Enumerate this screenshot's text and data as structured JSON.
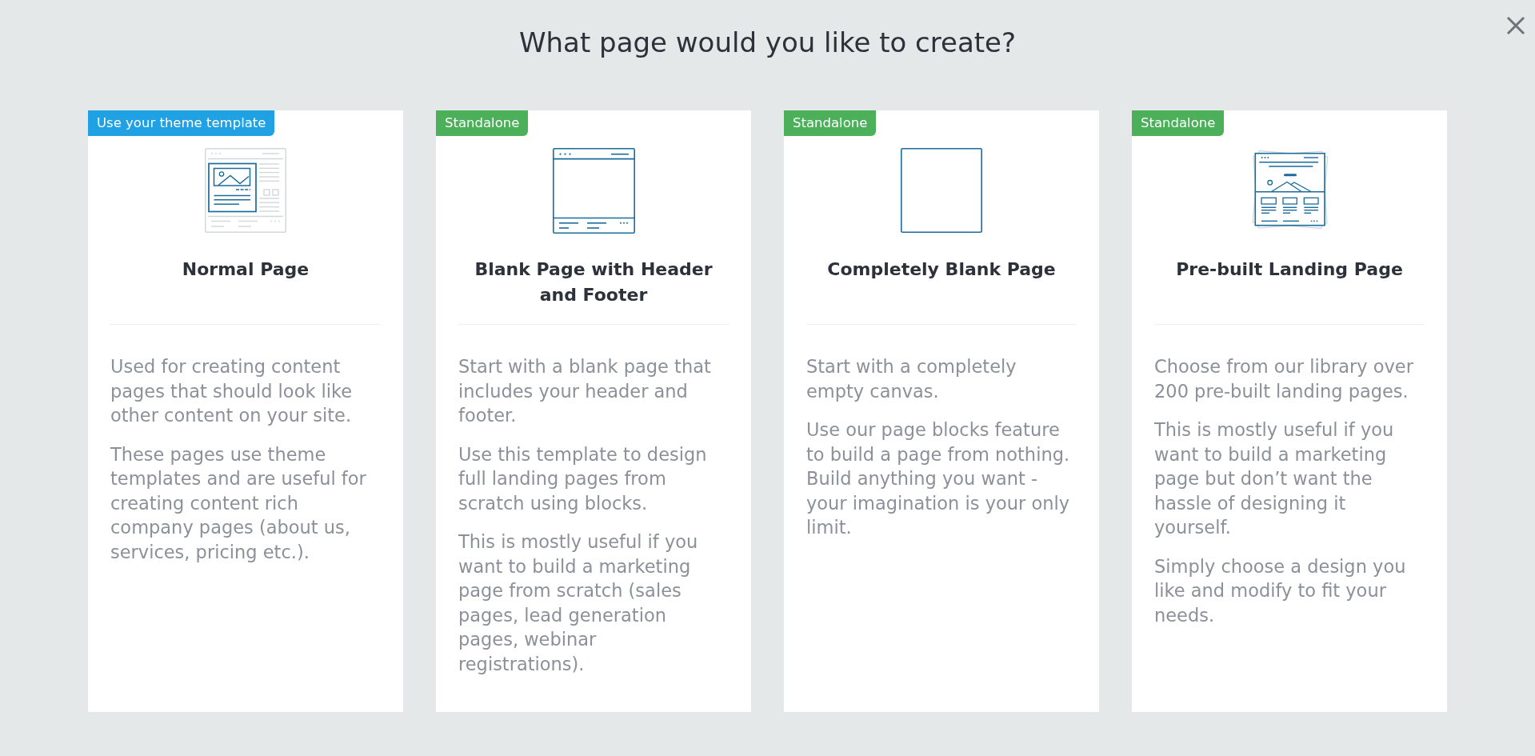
{
  "title": "What page would you like to create?",
  "cards": [
    {
      "badge": {
        "label": "Use your theme template",
        "color": "#1fa1e3"
      },
      "title": "Normal Page",
      "paragraphs": [
        "Used for creating content pages that should look like other content on your site.",
        "These pages use theme templates and are useful for creating content rich company pages (about us, services, pricing etc.)."
      ]
    },
    {
      "badge": {
        "label": "Standalone",
        "color": "#4caf5a"
      },
      "title": "Blank Page with Header and Footer",
      "paragraphs": [
        "Start with a blank page that includes your header and footer.",
        "Use this template to design full landing pages from scratch using blocks.",
        "This is mostly useful if you want to build a marketing page from scratch (sales pages, lead generation pages, webinar registrations)."
      ]
    },
    {
      "badge": {
        "label": "Standalone",
        "color": "#4caf5a"
      },
      "title": "Completely Blank Page",
      "paragraphs": [
        "Start with a completely empty canvas.",
        "Use our page blocks feature to build a page from nothing. Build anything you want - your imagination is your only limit."
      ]
    },
    {
      "badge": {
        "label": "Standalone",
        "color": "#4caf5a"
      },
      "title": "Pre-built Landing Page",
      "paragraphs": [
        "Choose from our library over 200 pre-built landing pages.",
        "This is mostly useful if you want to build a marketing page but don’t want the hassle of designing it yourself.",
        "Simply choose a design you like and modify to fit your needs."
      ]
    }
  ]
}
